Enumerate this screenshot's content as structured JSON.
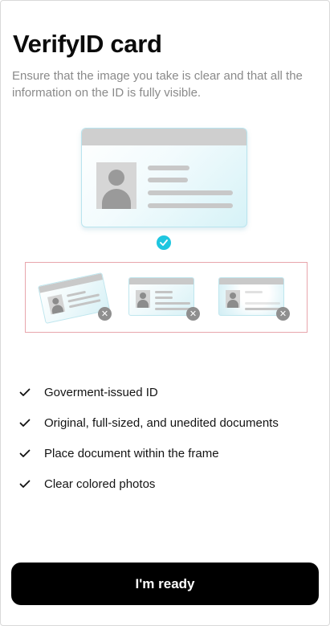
{
  "header": {
    "title": "VerifyID card",
    "subtitle": "Ensure that the image you take is clear and that all the information on the ID is fully visible."
  },
  "illustration": {
    "good_example_icon": "check-circle-icon",
    "bad_examples_icon": "x-circle-icon",
    "accent_color": "#1ec6e0",
    "frame_border_color": "#e8a5ac"
  },
  "requirements": [
    {
      "label": "Goverment-issued ID"
    },
    {
      "label": "Original, full-sized, and unedited documents"
    },
    {
      "label": "Place document within the frame"
    },
    {
      "label": "Clear colored photos"
    }
  ],
  "actions": {
    "ready_label": "I'm ready"
  }
}
